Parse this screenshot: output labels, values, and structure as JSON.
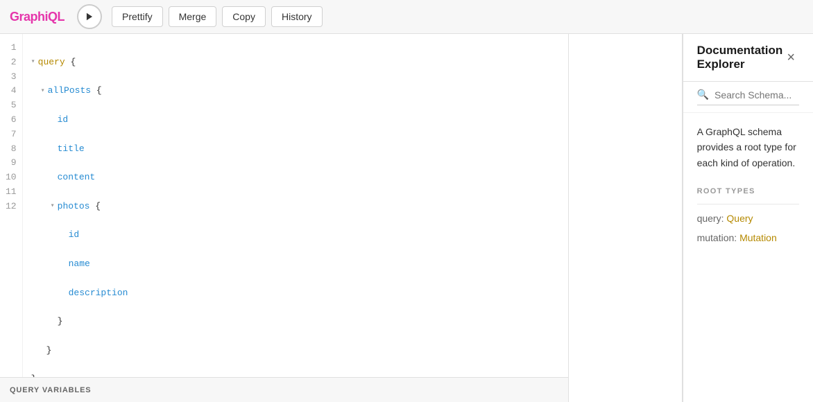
{
  "app": {
    "logo": "GraphiQL",
    "toolbar": {
      "prettify_label": "Prettify",
      "merge_label": "Merge",
      "copy_label": "Copy",
      "history_label": "History"
    }
  },
  "editor": {
    "lines": [
      {
        "num": "1",
        "indent": "",
        "triangle": "▾",
        "content_type": "keyword",
        "text": "query {"
      },
      {
        "num": "2",
        "indent": "  ",
        "triangle": "▾",
        "content_type": "field",
        "text": "allPosts {"
      },
      {
        "num": "3",
        "indent": "    ",
        "triangle": "",
        "content_type": "field",
        "text": "id"
      },
      {
        "num": "4",
        "indent": "    ",
        "triangle": "",
        "content_type": "field",
        "text": "title"
      },
      {
        "num": "5",
        "indent": "    ",
        "triangle": "",
        "content_type": "field",
        "text": "content"
      },
      {
        "num": "6",
        "indent": "    ",
        "triangle": "▾",
        "content_type": "field",
        "text": "photos {"
      },
      {
        "num": "7",
        "indent": "      ",
        "triangle": "",
        "content_type": "field",
        "text": "id"
      },
      {
        "num": "8",
        "indent": "      ",
        "triangle": "",
        "content_type": "field",
        "text": "name"
      },
      {
        "num": "9",
        "indent": "      ",
        "triangle": "",
        "content_type": "field",
        "text": "description"
      },
      {
        "num": "10",
        "indent": "    ",
        "triangle": "",
        "content_type": "brace",
        "text": "}"
      },
      {
        "num": "11",
        "indent": "  ",
        "triangle": "",
        "content_type": "brace",
        "text": "}"
      },
      {
        "num": "12",
        "indent": "",
        "triangle": "",
        "content_type": "brace",
        "text": "}"
      }
    ],
    "variables_label": "QUERY VARIABLES"
  },
  "docs": {
    "title": "Documentation Explorer",
    "close_label": "×",
    "search_placeholder": "Search Schema...",
    "description": "A GraphQL schema provides a root type for each kind of operation.",
    "root_types_heading": "ROOT TYPES",
    "root_types": [
      {
        "label": "query:",
        "link": "Query",
        "type": "query"
      },
      {
        "label": "mutation:",
        "link": "Mutation",
        "type": "mutation"
      }
    ]
  }
}
